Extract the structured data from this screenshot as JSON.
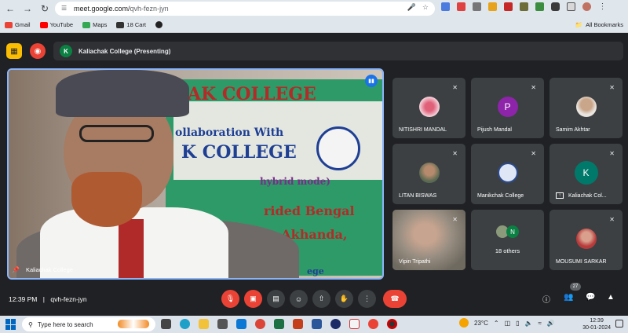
{
  "browser": {
    "url_host": "meet.google.com/",
    "url_path": "qvh-fezn-jyn",
    "bookmarks": [
      {
        "label": "Gmail",
        "color": "#ea4335"
      },
      {
        "label": "YouTube",
        "color": "#ff0000"
      },
      {
        "label": "Maps",
        "color": "#34a853"
      },
      {
        "label": "18 Cart",
        "color": "#333333"
      }
    ],
    "all_bookmarks": "All Bookmarks"
  },
  "meet": {
    "presenting_avatar": "K",
    "presenting_label": "Kaliachak College (Presenting)",
    "main_video_name": "Kaliachak College",
    "banner_lines": [
      "AK COLLEGE",
      "ollaboration With",
      "K COLLEGE",
      "hybrid mode)",
      "rided Bengal",
      "n Akhanda,",
      "ege"
    ],
    "tiles": [
      {
        "name": "NITISHRI MANDAL",
        "avatar": "",
        "avatar_color": "#f4c2c2"
      },
      {
        "name": "Pijush Mandal",
        "avatar": "P",
        "avatar_color": "#8e24aa"
      },
      {
        "name": "Samim Akhtar",
        "avatar": "",
        "avatar_color": "#c9a58a"
      },
      {
        "name": "LITAN BISWAS",
        "avatar": "",
        "avatar_color": "#7a8a6a"
      },
      {
        "name": "Manikchak College",
        "avatar": "",
        "avatar_color": "#dfe6f5"
      },
      {
        "name": "Kaliachak Col...",
        "avatar": "K",
        "avatar_color": "#00796b"
      },
      {
        "name": "Vipin Tripathi",
        "avatar": "",
        "avatar_color": "#8a8478"
      },
      {
        "name": "18 others",
        "avatar": "N",
        "avatar_color": "#0b8043"
      },
      {
        "name": "MOUSUMI SARKAR",
        "avatar": "",
        "avatar_color": "#e9b9a7"
      }
    ],
    "time": "12:39 PM",
    "separator": "|",
    "meeting_code": "qvh-fezn-jyn",
    "people_count": "27"
  },
  "taskbar": {
    "search_placeholder": "Type here to search",
    "temperature": "23°C",
    "clock_time": "12:39",
    "clock_date": "30-01-2024"
  }
}
